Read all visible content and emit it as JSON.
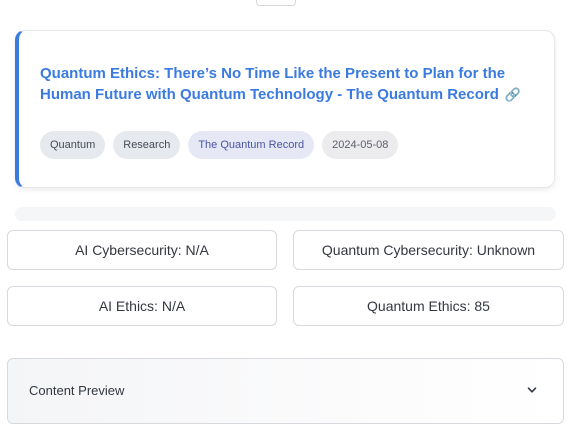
{
  "card": {
    "title": "Quantum Ethics: There’s No Time Like the Present to Plan for the Human Future with Quantum Technology - The Quantum Record",
    "link_icon": "🔗",
    "tags": [
      "Quantum",
      "Research"
    ],
    "source": "The Quantum Record",
    "date": "2024-05-08"
  },
  "metrics": {
    "ai_cybersecurity": "AI Cybersecurity: N/A",
    "quantum_cybersecurity": "Quantum Cybersecurity: Unknown",
    "ai_ethics": "AI Ethics: N/A",
    "quantum_ethics": "Quantum Ethics: 85"
  },
  "content_preview": {
    "label": "Content Preview",
    "icon": "chevron-down-icon"
  },
  "colors": {
    "accent": "#3b7be0",
    "source_tag_text": "#4a55a6"
  }
}
